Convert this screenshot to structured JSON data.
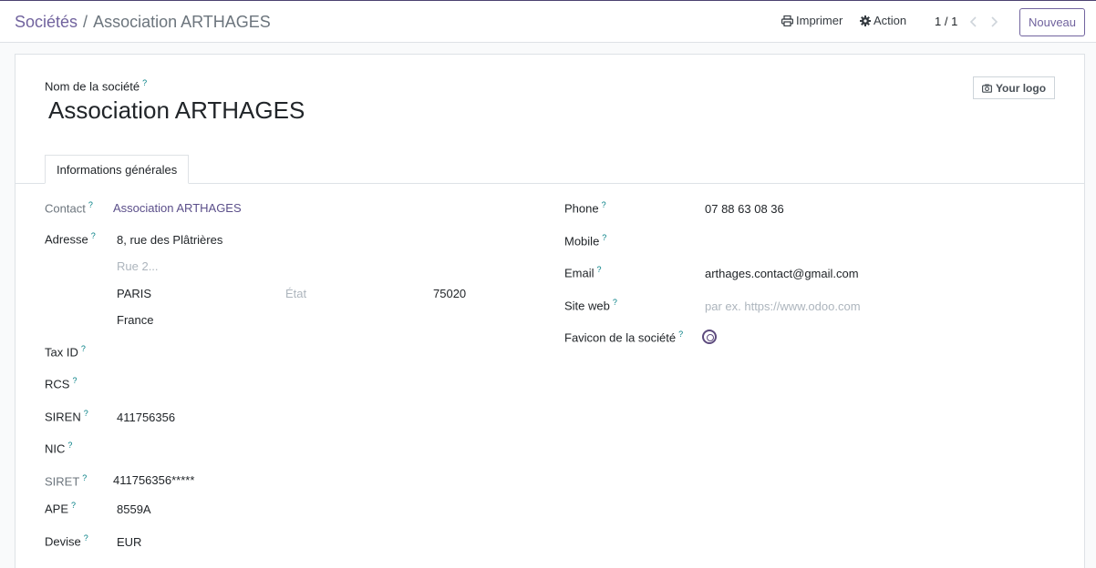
{
  "breadcrumb": {
    "parent": "Sociétés",
    "separator": "/",
    "current": "Association ARTHAGES"
  },
  "control_panel": {
    "print_label": "Imprimer",
    "action_label": "Action",
    "pager_value": "1 / 1",
    "new_label": "Nouveau"
  },
  "form": {
    "name_label": "Nom de la société",
    "help_mark": "?",
    "company_name": "Association ARTHAGES",
    "logo_label": "Your logo",
    "tab_label": "Informations générales",
    "left": {
      "contact_label": "Contact",
      "contact_value": "Association ARTHAGES",
      "address_label": "Adresse",
      "street": "8, rue des Plâtrières",
      "street2_placeholder": "Rue 2...",
      "city": "PARIS",
      "state_placeholder": "État",
      "zip": "75020",
      "country": "France",
      "tax_id_label": "Tax ID",
      "rcs_label": "RCS",
      "siren_label": "SIREN",
      "siren_value": "411756356",
      "nic_label": "NIC",
      "siret_label": "SIRET",
      "siret_value": "411756356*****",
      "ape_label": "APE",
      "ape_value": "8559A",
      "currency_label": "Devise",
      "currency_value": "EUR"
    },
    "right": {
      "phone_label": "Phone",
      "phone_value": "07 88 63 08 36",
      "mobile_label": "Mobile",
      "email_label": "Email",
      "email_value": "arthages.contact@gmail.com",
      "website_label": "Site web",
      "website_placeholder": "par ex. https://www.odoo.com",
      "favicon_label": "Favicon de la société"
    }
  },
  "colors": {
    "brand": "#71639e",
    "help": "#017e84",
    "link": "#5b4f8a"
  },
  "icons": {
    "print": "printer-icon",
    "action": "gear-icon",
    "prev": "chevron-left-icon",
    "next": "chevron-right-icon",
    "logo": "camera-icon"
  }
}
